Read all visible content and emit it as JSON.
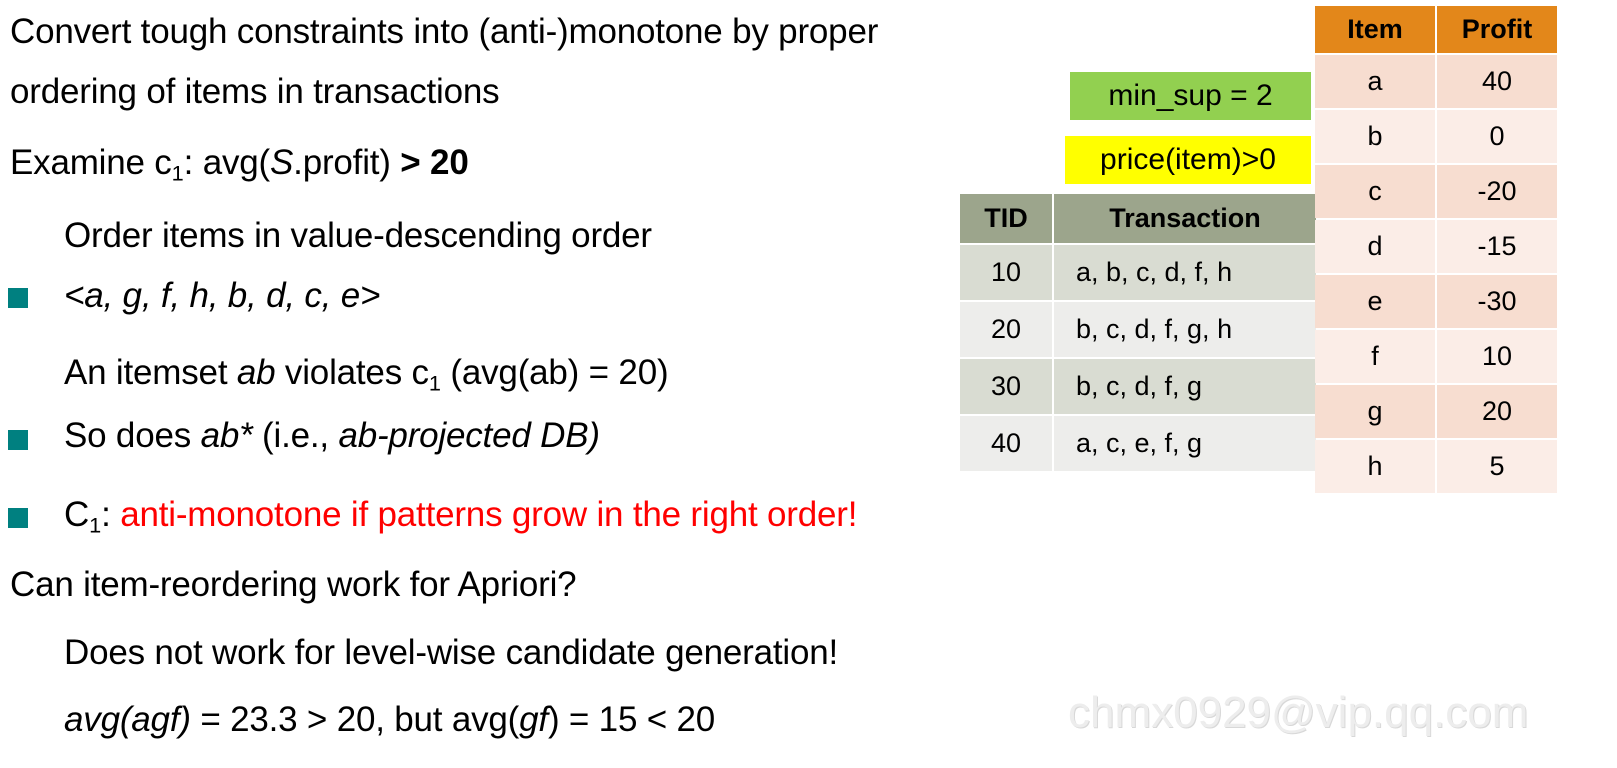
{
  "slide": {
    "lines": [
      {
        "id": "l1",
        "text": "Convert tough constraints into (anti-)monotone by proper"
      },
      {
        "id": "l2",
        "text": "ordering of items in transactions"
      },
      {
        "id": "l4",
        "text": "Order items in value-descending order"
      },
      {
        "id": "l7",
        "text": "Can item-reordering work for Apriori?"
      },
      {
        "id": "l8",
        "text": "Does not work for level-wise candidate generation!"
      }
    ],
    "line_examine": {
      "prefix": "Examine c",
      "sub": "1",
      "suffix": ": avg(",
      "italic": "S",
      "tail": ".profit) ",
      "operator": "> 20"
    },
    "line_order": {
      "text": "<a, g, f, h, b, d, c, e>"
    },
    "line_itemset": {
      "prefix": "An itemset ",
      "italic": "ab",
      "mid": " violates c",
      "sub": "1",
      "suffix": " (avg(ab) = 20)"
    },
    "line_sodoes": {
      "prefix": "So does ",
      "italic1": "ab*",
      "mid": " (i.e., ",
      "italic2": "ab-projected DB)"
    },
    "line_antimono": {
      "prefix": "C",
      "sub": "1",
      "colon": ": ",
      "red": "anti-monotone if patterns grow in the right order!"
    },
    "line_avg": {
      "i1": "avg(agf)",
      "t1": " = 23.3 > 20, but avg(",
      "i2": "gf",
      "t2": ") = 15 < 20"
    }
  },
  "callouts": {
    "min_sup": {
      "label": "min_sup = 2",
      "color": "#92D050"
    },
    "price": {
      "label": "price(item)>0",
      "color": "#FFFF00"
    }
  },
  "transaction_table": {
    "headers": [
      "TID",
      "Transaction"
    ],
    "rows": [
      {
        "tid": "10",
        "transaction": "a, b, c, d, f, h"
      },
      {
        "tid": "20",
        "transaction": "b, c, d, f, g, h"
      },
      {
        "tid": "30",
        "transaction": "b, c, d, f, g"
      },
      {
        "tid": "40",
        "transaction": "a, c, e, f, g"
      }
    ],
    "header_color": "#9CA58C"
  },
  "profit_table": {
    "headers": [
      "Item",
      "Profit"
    ],
    "rows": [
      {
        "item": "a",
        "profit": "40"
      },
      {
        "item": "b",
        "profit": "0"
      },
      {
        "item": "c",
        "profit": "-20"
      },
      {
        "item": "d",
        "profit": "-15"
      },
      {
        "item": "e",
        "profit": "-30"
      },
      {
        "item": "f",
        "profit": "10"
      },
      {
        "item": "g",
        "profit": "20"
      },
      {
        "item": "h",
        "profit": "5"
      }
    ],
    "header_color": "#E3871A"
  },
  "watermark": {
    "text": "chmx0929@vip.qq.com"
  },
  "theme": {
    "bullet_color": "#008080",
    "highlight_red": "#FF0000"
  }
}
